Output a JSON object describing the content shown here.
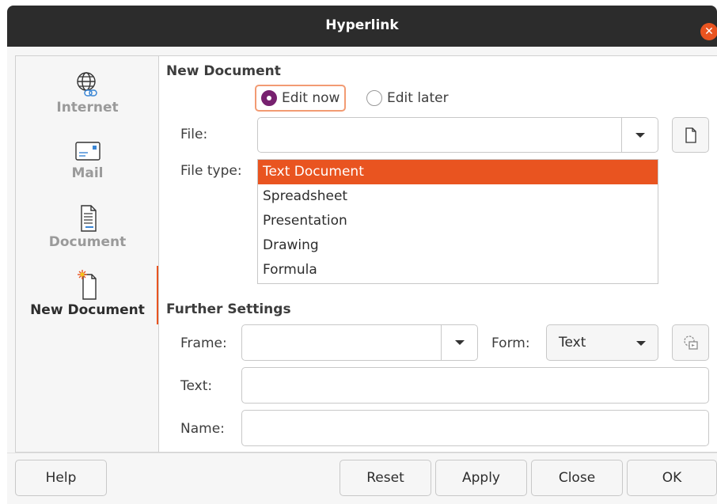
{
  "window": {
    "title": "Hyperlink",
    "close_icon": "close-icon",
    "accent": "#e95420"
  },
  "sidebar": {
    "items": [
      {
        "label": "Internet",
        "icon": "globe-link-icon",
        "active": false
      },
      {
        "label": "Mail",
        "icon": "mail-icon",
        "active": false
      },
      {
        "label": "Document",
        "icon": "document-icon",
        "active": false
      },
      {
        "label": "New Document",
        "icon": "new-document-icon",
        "active": true
      }
    ]
  },
  "new_document": {
    "heading": "New Document",
    "edit_now_label": "Edit now",
    "edit_later_label": "Edit later",
    "edit_mode_selected": "Edit now",
    "file_label": "File:",
    "file_value": "",
    "file_type_label": "File type:",
    "file_types": [
      "Text Document",
      "Spreadsheet",
      "Presentation",
      "Drawing",
      "Formula"
    ],
    "file_type_selected": "Text Document"
  },
  "further_settings": {
    "heading": "Further Settings",
    "frame_label": "Frame:",
    "frame_value": "",
    "form_label": "Form:",
    "form_value": "Text",
    "text_label": "Text:",
    "text_value": "",
    "name_label": "Name:",
    "name_value": ""
  },
  "buttons": {
    "help": "Help",
    "reset": "Reset",
    "apply": "Apply",
    "close": "Close",
    "ok": "OK"
  }
}
